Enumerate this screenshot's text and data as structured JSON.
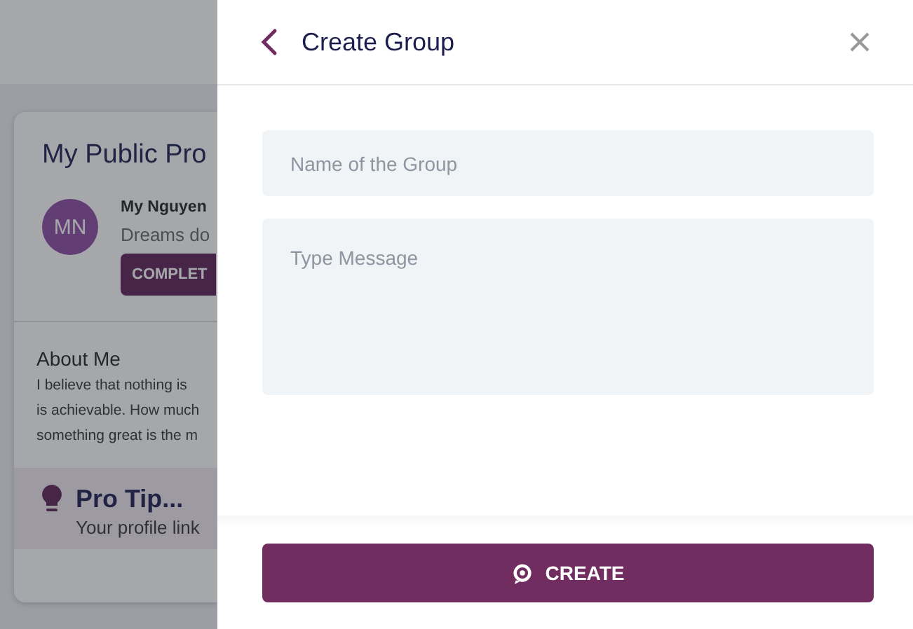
{
  "background_page": {
    "card_title": "My Public Pro",
    "avatar_initials": "MN",
    "user_name": "My Nguyen",
    "user_bio": "Dreams do",
    "complete_button": "COMPLET",
    "about_heading": "About Me",
    "about_lines": [
      "I believe that nothing is",
      "is achievable. How much",
      "something great is the m"
    ],
    "tip_title": "Pro Tip...",
    "tip_text": "Your profile link"
  },
  "drawer": {
    "title": "Create Group",
    "name_field": {
      "placeholder": "Name of the Group"
    },
    "message_field": {
      "placeholder": "Type Message"
    },
    "create_button": "CREATE"
  }
}
